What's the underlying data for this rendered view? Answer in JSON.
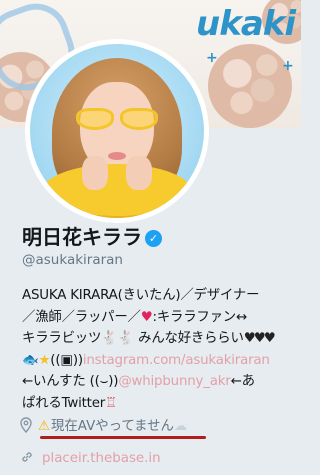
{
  "banner": {
    "text": "ukaki"
  },
  "profile": {
    "display_name": "明日花キララ",
    "verified_mark": "✓",
    "handle": "@asukakiraran"
  },
  "bio": {
    "line1": "ASUKA KIRARA(きいたん)／デザイナー",
    "line2": "／漁師／ラッパー／",
    "line2b": ":キララファン↔",
    "line3a": "キララビッツ",
    "line3b": " みんな好きららい",
    "line4a": "((",
    "line4_link": "instagram.com/asukakiraran",
    "line5a": "←いんすた ((",
    "line5_link": "@whipbunny_akr",
    "line5b": "←あ",
    "line6": "ぱれるTwitter"
  },
  "location": {
    "warn_glyph": "⚠",
    "text": "現在AVやってません"
  },
  "website": {
    "text": "placeir.thebase.in"
  },
  "icons": {
    "location": "map-pin-icon",
    "website": "link-icon",
    "verified": "verified-badge-icon"
  },
  "colors": {
    "background": "#e6ecf0",
    "link": "#e3a0a8",
    "accent": "#1da1f2",
    "underline": "#b01e1e"
  }
}
